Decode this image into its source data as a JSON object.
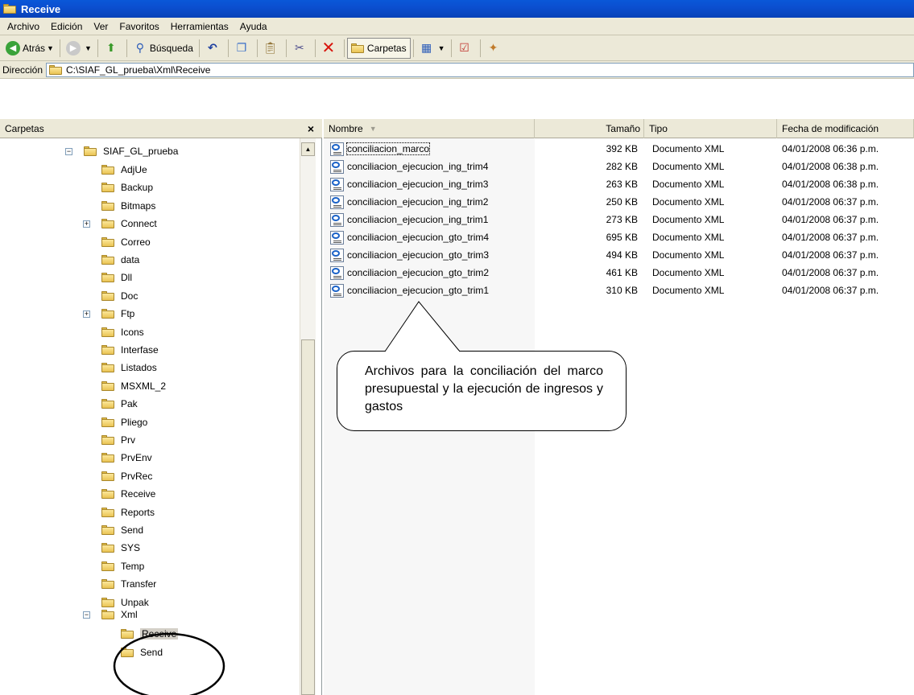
{
  "window": {
    "title": "Receive"
  },
  "menu": [
    "Archivo",
    "Edición",
    "Ver",
    "Favoritos",
    "Herramientas",
    "Ayuda"
  ],
  "toolbar": {
    "back": "Atrás",
    "search": "Búsqueda",
    "folders": "Carpetas"
  },
  "address": {
    "label": "Dirección",
    "path": "C:\\SIAF_GL_prueba\\Xml\\Receive"
  },
  "folders_pane": {
    "title": "Carpetas",
    "close": "×",
    "root": "SIAF_GL_prueba",
    "items": [
      "AdjUe",
      "Backup",
      "Bitmaps",
      "Connect",
      "Correo",
      "data",
      "Dll",
      "Doc",
      "Ftp",
      "Icons",
      "Interfase",
      "Listados",
      "MSXML_2",
      "Pak",
      "Pliego",
      "Prv",
      "PrvEnv",
      "PrvRec",
      "Receive",
      "Reports",
      "Send",
      "SYS",
      "Temp",
      "Transfer",
      "Unpak"
    ],
    "xml": "Xml",
    "xml_children": [
      "Receive",
      "Send"
    ]
  },
  "columns": {
    "name": "Nombre",
    "size": "Tamaño",
    "type": "Tipo",
    "date": "Fecha de modificación"
  },
  "files": [
    {
      "name": "conciliacion_marco",
      "size": "392 KB",
      "type": "Documento XML",
      "date": "04/01/2008 06:36 p.m."
    },
    {
      "name": "conciliacion_ejecucion_ing_trim4",
      "size": "282 KB",
      "type": "Documento XML",
      "date": "04/01/2008 06:38 p.m."
    },
    {
      "name": "conciliacion_ejecucion_ing_trim3",
      "size": "263 KB",
      "type": "Documento XML",
      "date": "04/01/2008 06:38 p.m."
    },
    {
      "name": "conciliacion_ejecucion_ing_trim2",
      "size": "250 KB",
      "type": "Documento XML",
      "date": "04/01/2008 06:37 p.m."
    },
    {
      "name": "conciliacion_ejecucion_ing_trim1",
      "size": "273 KB",
      "type": "Documento XML",
      "date": "04/01/2008 06:37 p.m."
    },
    {
      "name": "conciliacion_ejecucion_gto_trim4",
      "size": "695 KB",
      "type": "Documento XML",
      "date": "04/01/2008 06:37 p.m."
    },
    {
      "name": "conciliacion_ejecucion_gto_trim3",
      "size": "494 KB",
      "type": "Documento XML",
      "date": "04/01/2008 06:37 p.m."
    },
    {
      "name": "conciliacion_ejecucion_gto_trim2",
      "size": "461 KB",
      "type": "Documento XML",
      "date": "04/01/2008 06:37 p.m."
    },
    {
      "name": "conciliacion_ejecucion_gto_trim1",
      "size": "310 KB",
      "type": "Documento XML",
      "date": "04/01/2008 06:37 p.m."
    }
  ],
  "callout": {
    "text": "Archivos para la conciliación del marco presupuestal y la ejecución de ingresos y gastos"
  }
}
